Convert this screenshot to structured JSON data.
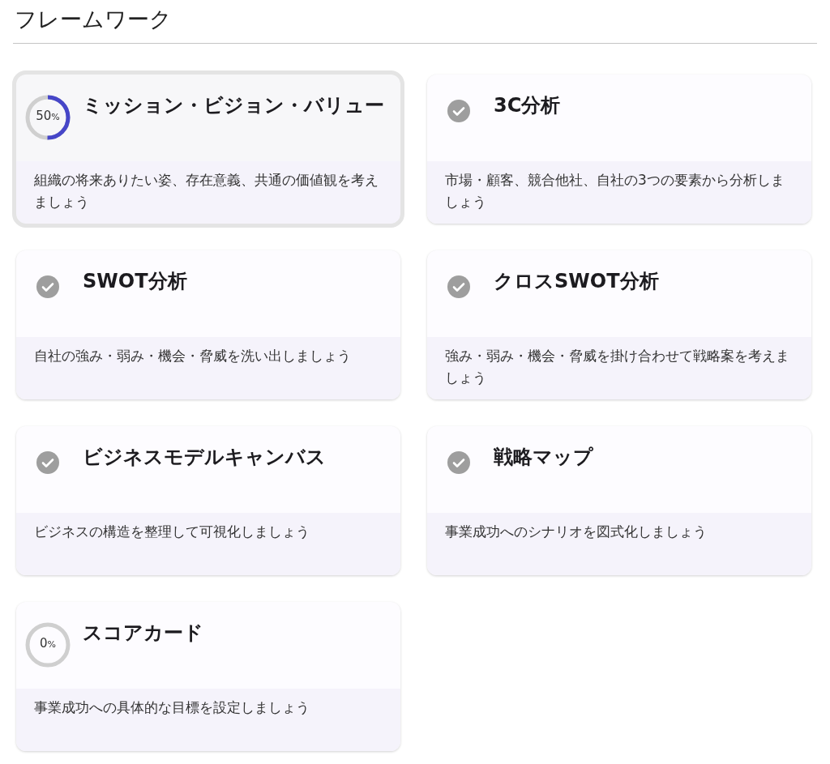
{
  "page_title": "フレームワーク",
  "cards": [
    {
      "kind": "progress",
      "level": 0.5,
      "reading": "50",
      "unit": "%",
      "title": "ミッション・ビジョン・バリュー",
      "description": "組織の将来ありたい姿、存在意義、共通の価値観を考えましょう",
      "selected": true
    },
    {
      "kind": "done",
      "title": "3C分析",
      "description": "市場・顧客、競合他社、自社の3つの要素から分析しましょう",
      "selected": false
    },
    {
      "kind": "done",
      "title": "SWOT分析",
      "description": "自社の強み・弱み・機会・脅威を洗い出しましょう",
      "selected": false
    },
    {
      "kind": "done",
      "title": "クロスSWOT分析",
      "description": "強み・弱み・機会・脅威を掛け合わせて戦略案を考えましょう",
      "selected": false
    },
    {
      "kind": "done",
      "title": "ビジネスモデルキャンバス",
      "description": "ビジネスの構造を整理して可視化しましょう",
      "selected": false
    },
    {
      "kind": "done",
      "title": "戦略マップ",
      "description": "事業成功へのシナリオを図式化しましょう",
      "selected": false
    },
    {
      "kind": "progress",
      "level": 0,
      "reading": "0",
      "unit": "%",
      "title": "スコアカード",
      "description": "事業成功への具体的な目標を設定しましょう",
      "selected": false
    }
  ]
}
